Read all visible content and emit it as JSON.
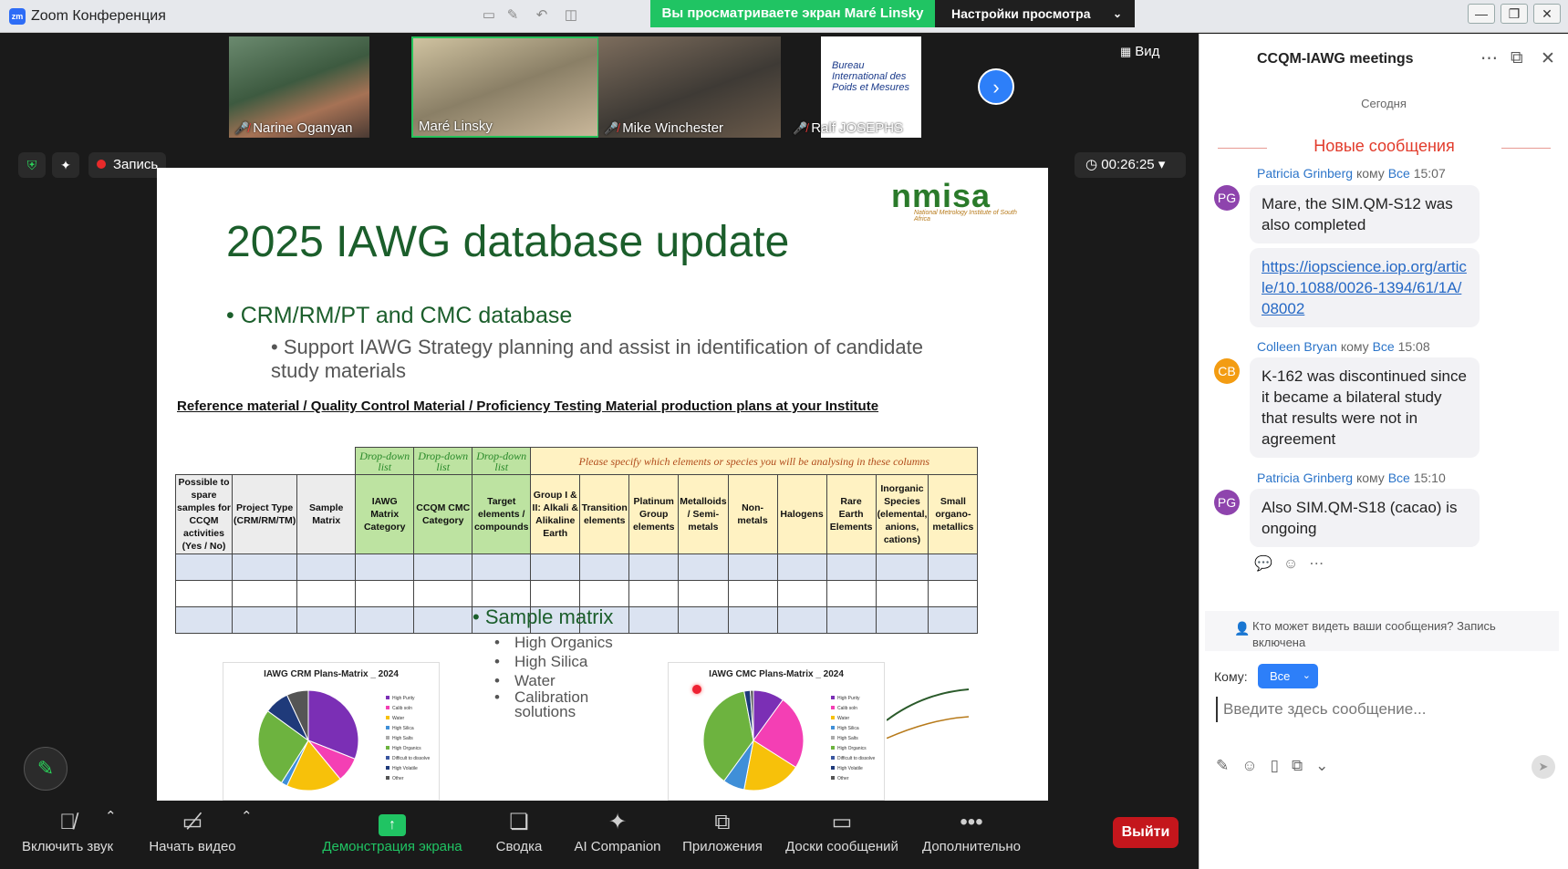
{
  "app": {
    "title": "Zoom Конференция",
    "share_banner": "Вы просматриваете экран Maré Linsky",
    "view_settings": "Настройки просмотра"
  },
  "participants": [
    {
      "name": "Narine Oganyan",
      "muted": true
    },
    {
      "name": "Maré Linsky",
      "muted": false
    },
    {
      "name": "Mike Winchester",
      "muted": true
    },
    {
      "name": "Ralf JOSEPHS",
      "muted": true
    }
  ],
  "bipm_logo_text": "Bureau International des Poids et Mesures",
  "view_button": "Вид",
  "status": {
    "record_label": "Запись",
    "timer": "00:26:25"
  },
  "slide": {
    "title": "2025 IAWG database update",
    "logo_text": "nmisa",
    "logo_sub": "National Metrology Institute of South Africa",
    "bullet1": "CRM/RM/PT and CMC database",
    "bullet2": "Support IAWG Strategy planning and assist in identification of candidate study materials",
    "table_heading": "Reference material / Quality Control Material / Proficiency Testing Material production plans at your Institute",
    "dropdown_label": "Drop-down list",
    "specify_label": "Please specify which elements or species you will be analysing in these columns",
    "columns": [
      "Possible to spare samples for CCQM activities (Yes / No)",
      "Project Type (CRM/RM/TM)",
      "Sample Matrix",
      "IAWG Matrix Category",
      "CCQM CMC Category",
      "Target elements / compounds",
      "Group I & II: Alkali & Alikaline Earth",
      "Transition elements",
      "Platinum Group elements",
      "Metalloids / Semi-metals",
      "Non-metals",
      "Halogens",
      "Rare Earth Elements",
      "Inorganic Species (elemental, anions, cations)",
      "Small organo-metallics"
    ],
    "sample_matrix_title": "Sample matrix",
    "sample_matrix_items": [
      "High Organics",
      "High Silica",
      "Water",
      "Calibration solutions"
    ],
    "chart1_title": "IAWG CRM Plans-Matrix _ 2024",
    "chart2_title": "IAWG CMC Plans-Matrix _ 2024",
    "legend_items": [
      "High Purity",
      "Calib soln",
      "Water",
      "High Silica",
      "High Salts",
      "High Organics",
      "Difficult to dissolve",
      "High Volatile",
      "Other"
    ]
  },
  "chart_data": [
    {
      "type": "pie",
      "title": "IAWG CRM Plans-Matrix _ 2024",
      "categories": [
        "High Purity",
        "Calib soln",
        "Water",
        "High Silica",
        "High Salts",
        "High Organics",
        "Difficult to dissolve",
        "High Volatile",
        "Other"
      ],
      "values": [
        31,
        8,
        18,
        2,
        0,
        26,
        0,
        8,
        7
      ],
      "colors": [
        "#7b2fb5",
        "#f43fb4",
        "#f7c10a",
        "#3f8fd8",
        "#aaaaaa",
        "#6db33f",
        "#3a56a0",
        "#1f3a7a",
        "#555555"
      ]
    },
    {
      "type": "pie",
      "title": "IAWG CMC Plans-Matrix _ 2024",
      "categories": [
        "High Purity",
        "Calib soln",
        "Water",
        "High Silica",
        "High Salts",
        "High Organics",
        "Difficult to dissolve",
        "High Volatile",
        "Other"
      ],
      "values": [
        10,
        24,
        19,
        7,
        0,
        37,
        0,
        2,
        1
      ],
      "colors": [
        "#7b2fb5",
        "#f43fb4",
        "#f7c10a",
        "#3f8fd8",
        "#aaaaaa",
        "#6db33f",
        "#3a56a0",
        "#1f3a7a",
        "#555555"
      ]
    }
  ],
  "toolbar": {
    "mute": "Включить звук",
    "video": "Начать видео",
    "share": "Демонстрация экрана",
    "summary": "Сводка",
    "ai": "AI Companion",
    "apps": "Приложения",
    "whiteboards": "Доски сообщений",
    "more": "Дополнительно",
    "leave": "Выйти"
  },
  "chat": {
    "title": "CCQM-IAWG meetings",
    "today": "Сегодня",
    "new_messages": "Новые сообщения",
    "to_word": "кому",
    "everyone": "Все",
    "messages": [
      {
        "initials": "PG",
        "sender": "Patricia Grinberg",
        "time": "15:07",
        "color": "#8e44ad",
        "text": "Mare, the SIM.QM-S12 was also completed"
      },
      {
        "link": "https://iopscience.iop.org/article/10.1088/0026-1394/61/1A/08002"
      },
      {
        "initials": "CB",
        "sender": "Colleen Bryan",
        "time": "15:08",
        "color": "#f39c12",
        "text": "K-162 was discontinued since it became a bilateral study that results were not in agreement"
      },
      {
        "initials": "PG",
        "sender": "Patricia Grinberg",
        "time": "15:10",
        "color": "#8e44ad",
        "text": "Also SIM.QM-S18 (cacao) is ongoing"
      }
    ],
    "who_sees": "Кто может видеть ваши сообщения? Запись включена",
    "to_label": "Кому:",
    "to_value": "Все",
    "input_placeholder": "Введите здесь сообщение..."
  }
}
